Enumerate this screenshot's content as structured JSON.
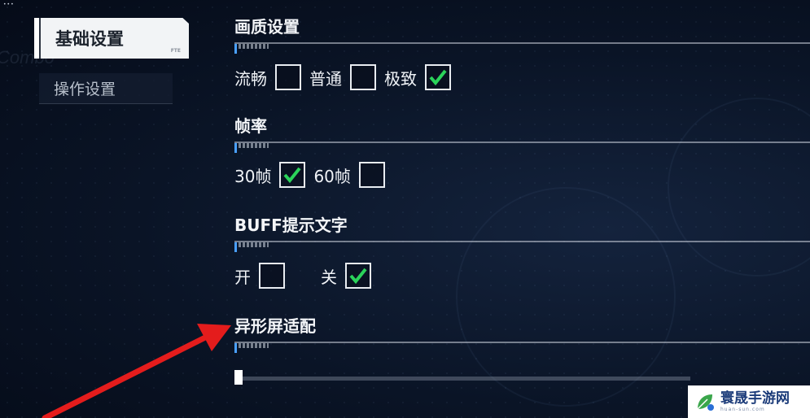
{
  "colors": {
    "check": "#2bd35a",
    "arrow": "#e41c1c",
    "watermark_text": "#1c3c7a"
  },
  "window_dots": "•••",
  "background_text": "Combo",
  "nav": {
    "active": {
      "label": "基础设置",
      "corner_mark": "FTE"
    },
    "items": [
      {
        "label": "操作设置"
      }
    ]
  },
  "sections": [
    {
      "title": "画质设置",
      "options": [
        {
          "label": "流畅",
          "checked": false
        },
        {
          "label": "普通",
          "checked": false
        },
        {
          "label": "极致",
          "checked": true
        }
      ]
    },
    {
      "title": "帧率",
      "options": [
        {
          "label": "30帧",
          "checked": true
        },
        {
          "label": "60帧",
          "checked": false
        }
      ]
    },
    {
      "title": "BUFF提示文字",
      "options": [
        {
          "label": "开",
          "checked": false
        },
        {
          "label": "关",
          "checked": true
        }
      ]
    },
    {
      "title": "异形屏适配",
      "slider_value": 0
    }
  ],
  "watermark": {
    "name": "寰晟手游网",
    "url": "huan-sun.com",
    "icon": "leaf-logo-icon"
  }
}
